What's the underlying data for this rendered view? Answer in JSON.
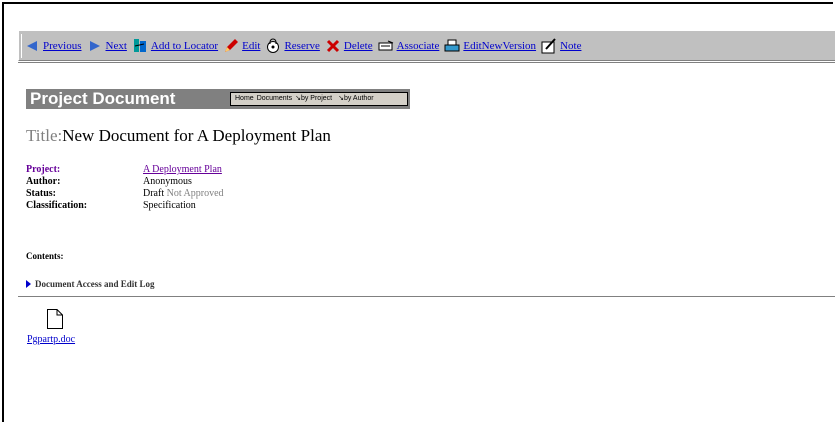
{
  "toolbar": {
    "items": [
      {
        "label": "Previous"
      },
      {
        "label": "Next"
      },
      {
        "label": "Add to Locator"
      },
      {
        "label": "Edit"
      },
      {
        "label": "Reserve"
      },
      {
        "label": "Delete"
      },
      {
        "label": "Associate"
      },
      {
        "label": "EditNewVersion"
      },
      {
        "label": "Note"
      }
    ]
  },
  "header": {
    "title": "Project Document",
    "nav": {
      "home": "Home",
      "documents": "Documents",
      "by_project": "by Project",
      "by_author": "by Author"
    }
  },
  "document": {
    "title_label": "Title:",
    "title_value": "New Document for A Deployment Plan",
    "project_label": "Project:",
    "project_value": "A Deployment Plan",
    "author_label": "Author:",
    "author_value": "Anonymous",
    "status_label": "Status:",
    "status_value": "Draft",
    "status_approval": "Not Approved",
    "classification_label": "Classification:",
    "classification_value": "Specification",
    "contents_label": "Contents:",
    "log_label": "Document Access and Edit Log",
    "attachment": "Pgpartp.doc"
  },
  "colors": {
    "toolbar_bg": "#c0c0c0",
    "header_bg": "#808080",
    "link": "#0000cc",
    "visited": "#660099"
  }
}
